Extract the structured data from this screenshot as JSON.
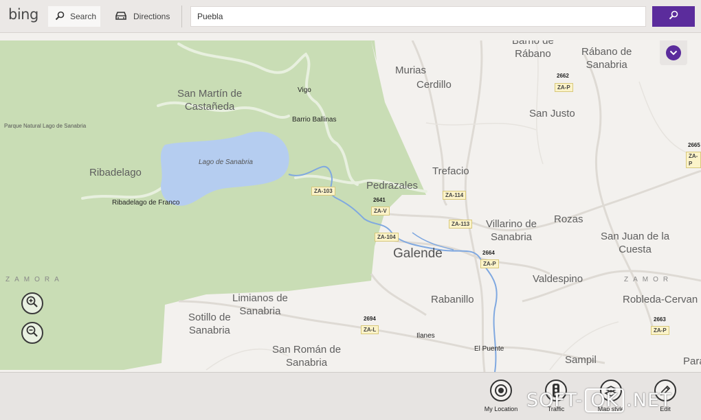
{
  "topbar": {
    "logo": "bing",
    "search_label": "Search",
    "directions_label": "Directions",
    "query": "Puebla"
  },
  "colors": {
    "accent": "#5b2c9c",
    "park": "#c8dcb4",
    "water": "#b4cdf0",
    "river": "#7fa8e0"
  },
  "map": {
    "places": {
      "barrio_de_rabano": "Barrio de\nRábano",
      "rabano_de_sanabria": "Rábano de\nSanabria",
      "murias": "Murias",
      "cerdillo": "Cerdillo",
      "san_martin": "San Martín de\nCastañeda",
      "vigo": "Vigo",
      "san_justo": "San Justo",
      "parque": "Parque Natural Lago de Sanabria",
      "barrio_ballinas": "Barrio Ballinas",
      "lago": "Lago de Sanabria",
      "ribadelago": "Ribadelago",
      "trefacio": "Trefacio",
      "pedrazales": "Pedrazales",
      "ribadelago_franco": "Ribadelago de Franco",
      "villarino": "Villarino de\nSanabria",
      "rozas": "Rozas",
      "san_juan": "San Juan de la\nCuesta",
      "galende": "Galende",
      "zamora_left": "ZAMORA",
      "valdespino": "Valdespino",
      "zamora_right": "ZAMOR",
      "limianos": "Limianos de\nSanabria",
      "rabanillo": "Rabanillo",
      "robleda": "Robleda-Cervan",
      "sotillo": "Sotillo de\nSanabria",
      "ilanes": "Ilanes",
      "el_puente": "El Puente",
      "san_roman": "San Román de\nSanabria",
      "sampil": "Sampil",
      "para": "Para"
    },
    "roads": {
      "za_p_1": "ZA-P",
      "n_2662": "2662",
      "za_103": "ZA-103",
      "za_114": "ZA-114",
      "n_2641": "2641",
      "za_v": "ZA-V",
      "za_113": "ZA-113",
      "za_104": "ZA-104",
      "n_2664": "2664",
      "za_p_2": "ZA-P",
      "n_2694": "2694",
      "za_l": "ZA-L",
      "n_2663": "2663",
      "za_p_3": "ZA-P",
      "n_2665": "2665",
      "za_p_4": "ZA-P"
    }
  },
  "appbar": {
    "my_location": "My Location",
    "traffic": "Traffic",
    "map_style": "Map style",
    "edit": "Edit"
  },
  "watermark": {
    "left": "SOFT-",
    "box": "OK",
    "right": ".NET"
  }
}
